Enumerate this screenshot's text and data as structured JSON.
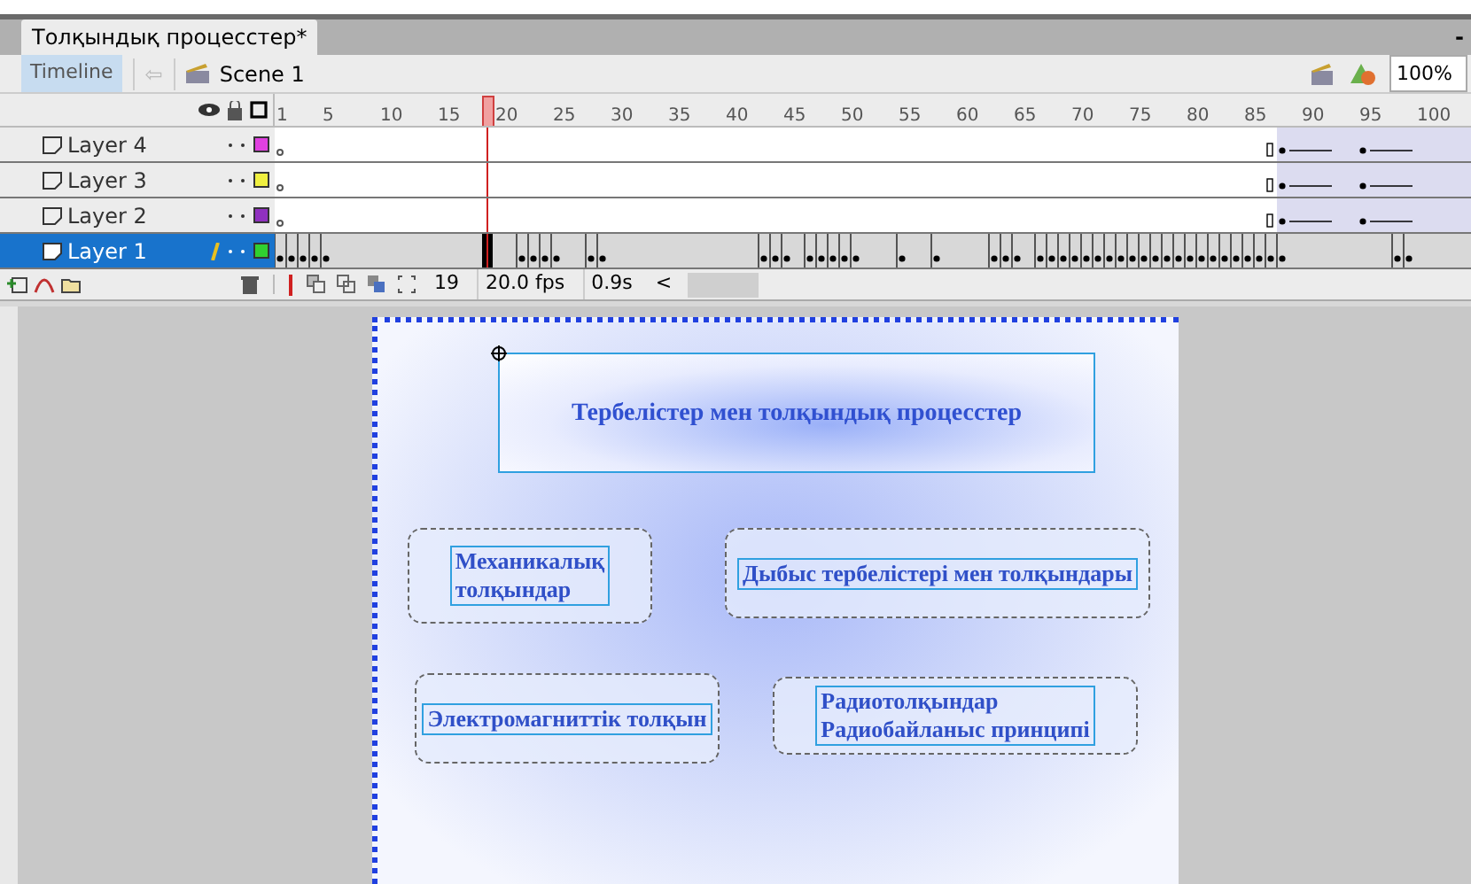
{
  "document_tab": {
    "title": "Толқындық процесстер*",
    "selected": true
  },
  "toolbar": {
    "timeline_button": "Timeline",
    "back_arrow": "⇦",
    "scene": "Scene 1",
    "zoom": "100%",
    "minimize": "-"
  },
  "ruler": {
    "labels": [
      "1",
      "5",
      "10",
      "15",
      "20",
      "25",
      "30",
      "35",
      "40",
      "45",
      "50",
      "55",
      "60",
      "65",
      "70",
      "75",
      "80",
      "85",
      "90",
      "95",
      "100"
    ]
  },
  "layers": [
    {
      "name": "Layer 4",
      "selected": false,
      "color": "#e040e0",
      "editing": false
    },
    {
      "name": "Layer 3",
      "selected": false,
      "color": "#f0f040",
      "editing": false
    },
    {
      "name": "Layer 2",
      "selected": false,
      "color": "#9030c0",
      "editing": false
    },
    {
      "name": "Layer 1",
      "selected": true,
      "color": "#30d030",
      "editing": true
    }
  ],
  "status": {
    "current_frame": "19",
    "frame_rate": "20.0 fps",
    "elapsed": "0.9s",
    "scroll_left": "<"
  },
  "stage": {
    "title": "Тербелістер мен толқындық процесстер",
    "items": [
      {
        "lines": [
          "Механикалық",
          "толқындар"
        ]
      },
      {
        "lines": [
          "Дыбыс тербелістері мен толқындары"
        ]
      },
      {
        "lines": [
          "Электромагниттік толқын"
        ]
      },
      {
        "lines": [
          "Радиотолқындар",
          "Радиобайланыс принципі"
        ]
      }
    ]
  }
}
